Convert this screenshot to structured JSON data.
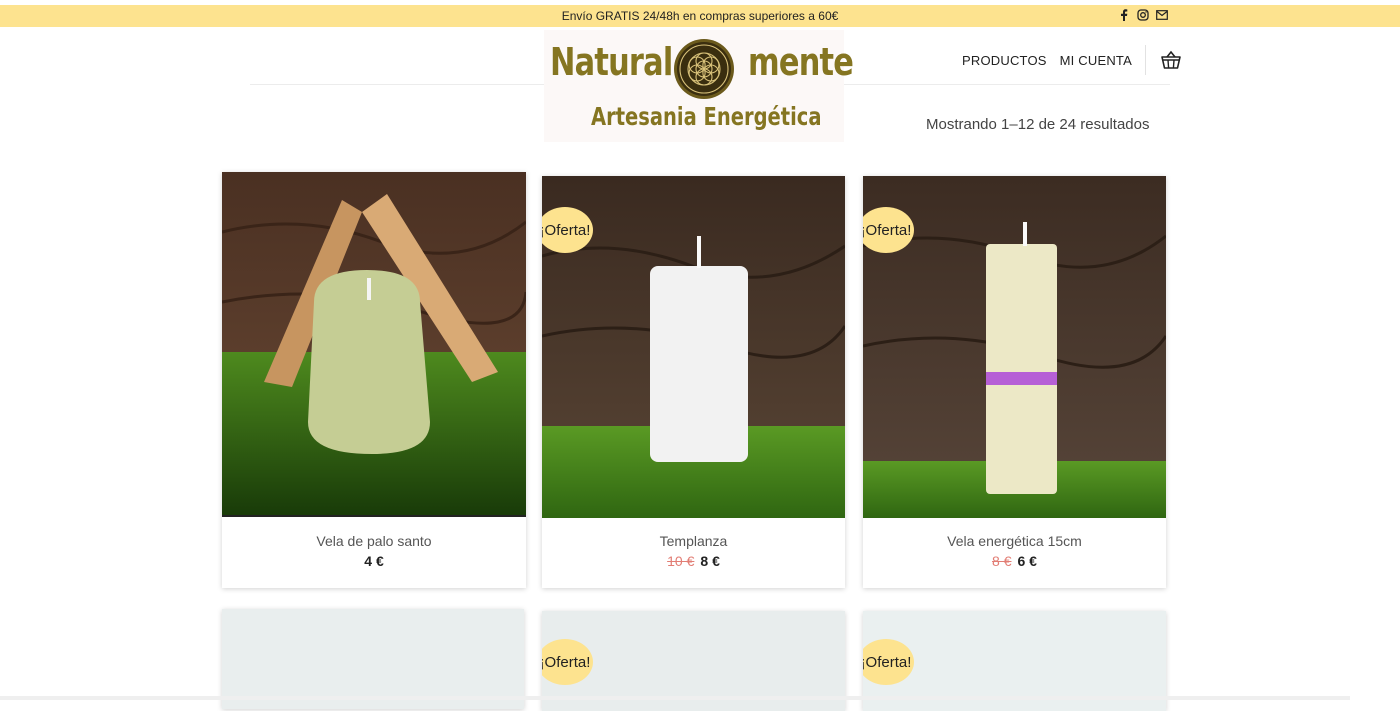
{
  "topbar": {
    "message": "Envío GRATIS 24/48h en compras superiores a 60€",
    "social": [
      "facebook-icon",
      "instagram-icon",
      "mail-icon"
    ],
    "background": "#fde38f"
  },
  "logo": {
    "word_left": "Natural",
    "word_right": "mente",
    "subtitle": "Artesania Energética",
    "color": "#857521"
  },
  "nav": {
    "productos": "PRODUCTOS",
    "mi_cuenta": "MI CUENTA",
    "cart_icon": "basket-icon"
  },
  "results": {
    "text": "Mostrando 1–12 de 24 resultados"
  },
  "badge_label": "¡Oferta!",
  "products": [
    {
      "title": "Vela de palo santo",
      "old_price": "",
      "price": "4 €",
      "on_sale": false
    },
    {
      "title": "Templanza",
      "old_price": "10 €",
      "price": "8 €",
      "on_sale": true
    },
    {
      "title": "Vela energética 15cm",
      "old_price": "8 €",
      "price": "6 €",
      "on_sale": true
    },
    {
      "title": "",
      "old_price": "",
      "price": "",
      "on_sale": false
    },
    {
      "title": "",
      "old_price": "",
      "price": "",
      "on_sale": true
    },
    {
      "title": "",
      "old_price": "",
      "price": "",
      "on_sale": true
    }
  ]
}
